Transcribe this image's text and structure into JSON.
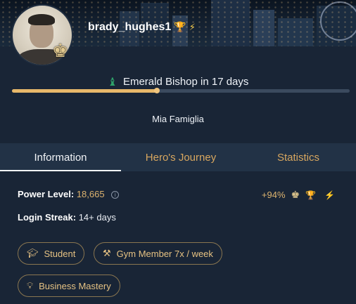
{
  "profile": {
    "username": "brady_hughes1",
    "icons": [
      "trophy-icon",
      "lightning-icon"
    ],
    "avatar_badge_icon": "king-chess-icon"
  },
  "next_rank": {
    "icon": "bishop-chess-icon",
    "text": "Emerald Bishop in 17 days",
    "progress_fraction": 0.43
  },
  "clan": {
    "name": "Mia Famiglia"
  },
  "tabs": [
    {
      "label": "Information",
      "active": true
    },
    {
      "label": "Hero's Journey",
      "active": false
    },
    {
      "label": "Statistics",
      "active": false
    }
  ],
  "info": {
    "power_level_label": "Power Level:",
    "power_level_value": "18,665",
    "login_streak_label": "Login Streak:",
    "login_streak_value": "14+ days",
    "change_percent": "+94%"
  },
  "chips": [
    {
      "icon": "graduation-cap-icon",
      "label": "Student"
    },
    {
      "icon": "dumbbell-icon",
      "label": "Gym Member 7x / week"
    },
    {
      "icon": "lightbulb-icon",
      "label": "Business Mastery"
    }
  ],
  "colors": {
    "background": "#192536",
    "accent_gold": "#dcb36f",
    "progress_fill": "#e7b86a",
    "bishop_green": "#2ea36a"
  }
}
